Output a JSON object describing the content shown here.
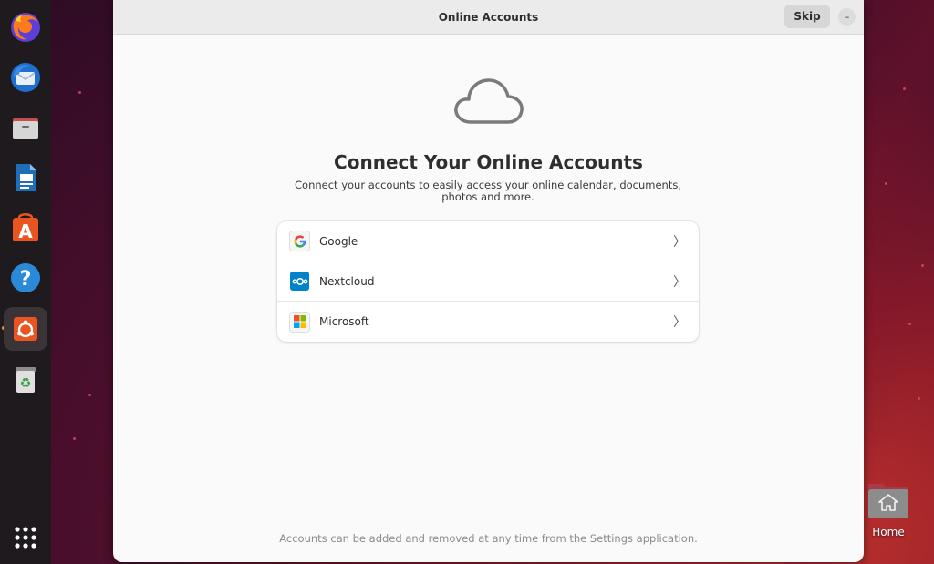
{
  "window": {
    "title": "Online Accounts",
    "skip_label": "Skip",
    "minimize_label": "–"
  },
  "main": {
    "heading": "Connect Your Online Accounts",
    "subtitle": "Connect your accounts to easily access your online calendar, documents, photos and more.",
    "providers": [
      {
        "label": "Google",
        "icon": "google-icon"
      },
      {
        "label": "Nextcloud",
        "icon": "nextcloud-icon"
      },
      {
        "label": "Microsoft",
        "icon": "microsoft-icon"
      }
    ],
    "footer": "Accounts can be added and removed at any time from the Settings application."
  },
  "desktop": {
    "home_label": "Home"
  },
  "dock": {
    "items": [
      "firefox-icon",
      "thunderbird-icon",
      "files-icon",
      "libreoffice-writer-icon",
      "app-center-icon",
      "help-icon",
      "ubuntu-installer-icon",
      "trash-icon"
    ],
    "apps_grid": "show-apps-icon"
  },
  "colors": {
    "google_blue": "#4285f4",
    "nextcloud_blue": "#0082c9",
    "ubuntu_orange": "#e95420"
  }
}
